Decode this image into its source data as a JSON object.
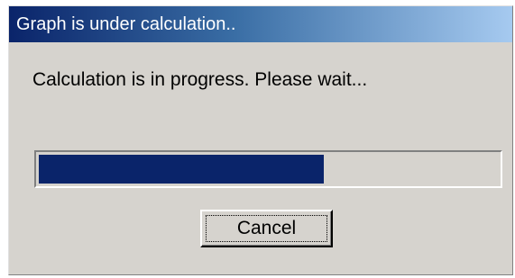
{
  "window": {
    "title": "Graph is under calculation.."
  },
  "dialog": {
    "message": "Calculation is in progress. Please wait..."
  },
  "progress": {
    "fraction": 0.62,
    "fill_color": "#0a246a"
  },
  "buttons": {
    "cancel_label": "Cancel"
  }
}
